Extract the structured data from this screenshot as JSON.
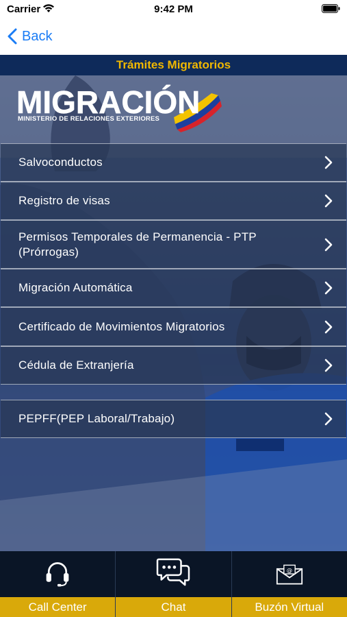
{
  "status_bar": {
    "carrier": "Carrier",
    "time": "9:42 PM"
  },
  "nav": {
    "back_label": "Back"
  },
  "header": {
    "title": "Trámites Migratorios"
  },
  "logo": {
    "word": "MIGRACIÓN",
    "subtitle": "MINISTERIO DE RELACIONES EXTERIORES"
  },
  "menu": {
    "items": [
      {
        "label": "Salvoconductos"
      },
      {
        "label": "Registro de visas"
      },
      {
        "label": "Permisos Temporales de Permanencia - PTP (Prórrogas)"
      },
      {
        "label": "Migración Automática"
      },
      {
        "label": "Certificado de Movimientos Migratorios"
      },
      {
        "label": "Cédula de Extranjería"
      },
      {
        "label": "PEPFF(PEP Laboral/Trabajo)"
      }
    ]
  },
  "tabs": [
    {
      "label": "Call Center",
      "icon": "headset-icon"
    },
    {
      "label": "Chat",
      "icon": "chat-icon"
    },
    {
      "label": "Buzón Virtual",
      "icon": "mail-icon"
    }
  ],
  "colors": {
    "title_bar_bg": "#0e2a5a",
    "title_text": "#f1b800",
    "tab_label_bg": "#d9a90a",
    "tab_bg": "#0a1526",
    "ios_blue": "#1a7cf5"
  }
}
